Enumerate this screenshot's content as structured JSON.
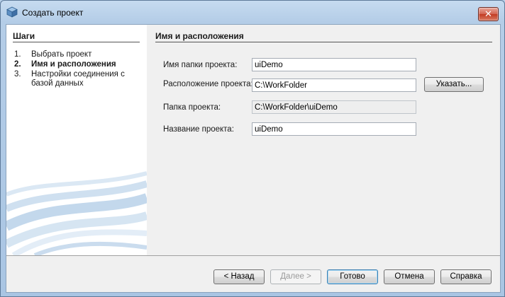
{
  "window": {
    "title": "Создать проект",
    "close_glyph": "✕"
  },
  "steps": {
    "header": "Шаги",
    "items": [
      {
        "num": "1.",
        "label": "Выбрать проект"
      },
      {
        "num": "2.",
        "label": "Имя и расположения"
      },
      {
        "num": "3.",
        "label": "Настройки соединения с базой данных"
      }
    ],
    "current_index": 1
  },
  "section": {
    "title": "Имя и расположения"
  },
  "form": {
    "folder_name_label": "Имя папки проекта:",
    "folder_name_value": "uiDemo",
    "location_label": "Расположение проекта:",
    "location_value": "C:\\WorkFolder",
    "browse_button": "Указать...",
    "project_folder_label": "Папка проекта:",
    "project_folder_value": "C:\\WorkFolder\\uiDemo",
    "project_name_label": "Название проекта:",
    "project_name_value": "uiDemo"
  },
  "buttons": {
    "back": "< Назад",
    "next": "Далее >",
    "finish": "Готово",
    "cancel": "Отмена",
    "help": "Справка"
  },
  "icons": {
    "app": "netbeans-cube-icon",
    "close": "close-icon"
  },
  "colors": {
    "title_bar": "#b4cde7",
    "close_button": "#c23b22",
    "left_pane": "#ffffff",
    "swoosh": "#c9dced"
  }
}
